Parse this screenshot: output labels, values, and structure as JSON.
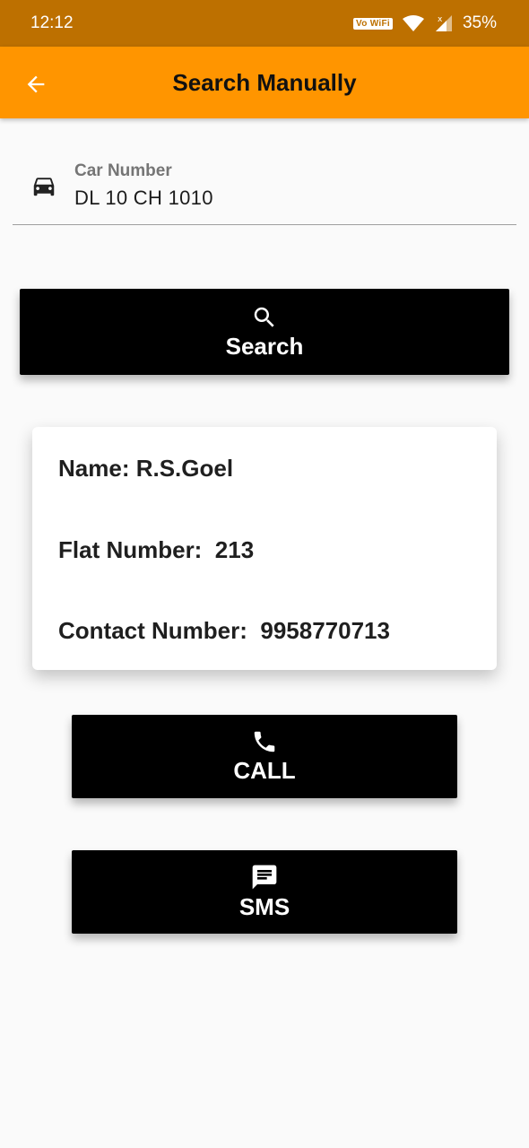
{
  "status_bar": {
    "time": "12:12",
    "vowifi": "Vo WiFi",
    "battery": "35%"
  },
  "app_bar": {
    "title": "Search Manually",
    "back_icon": "arrow-left-icon"
  },
  "car_field": {
    "label": "Car Number",
    "value": "DL 10 CH 1010",
    "icon": "car-icon"
  },
  "search_button": {
    "label": "Search",
    "icon": "search-icon"
  },
  "result_card": {
    "name_label": "Name:",
    "name_value": "R.S.Goel",
    "flat_label": "Flat Number:",
    "flat_value": "213",
    "contact_label": "Contact Number:",
    "contact_value": "9958770713"
  },
  "call_button": {
    "label": "CALL",
    "icon": "phone-icon"
  },
  "sms_button": {
    "label": "SMS",
    "icon": "message-icon"
  },
  "colors": {
    "status_bar": "#bd7000",
    "app_bar": "#ff9500",
    "button": "#000000",
    "background": "#fafafa"
  }
}
